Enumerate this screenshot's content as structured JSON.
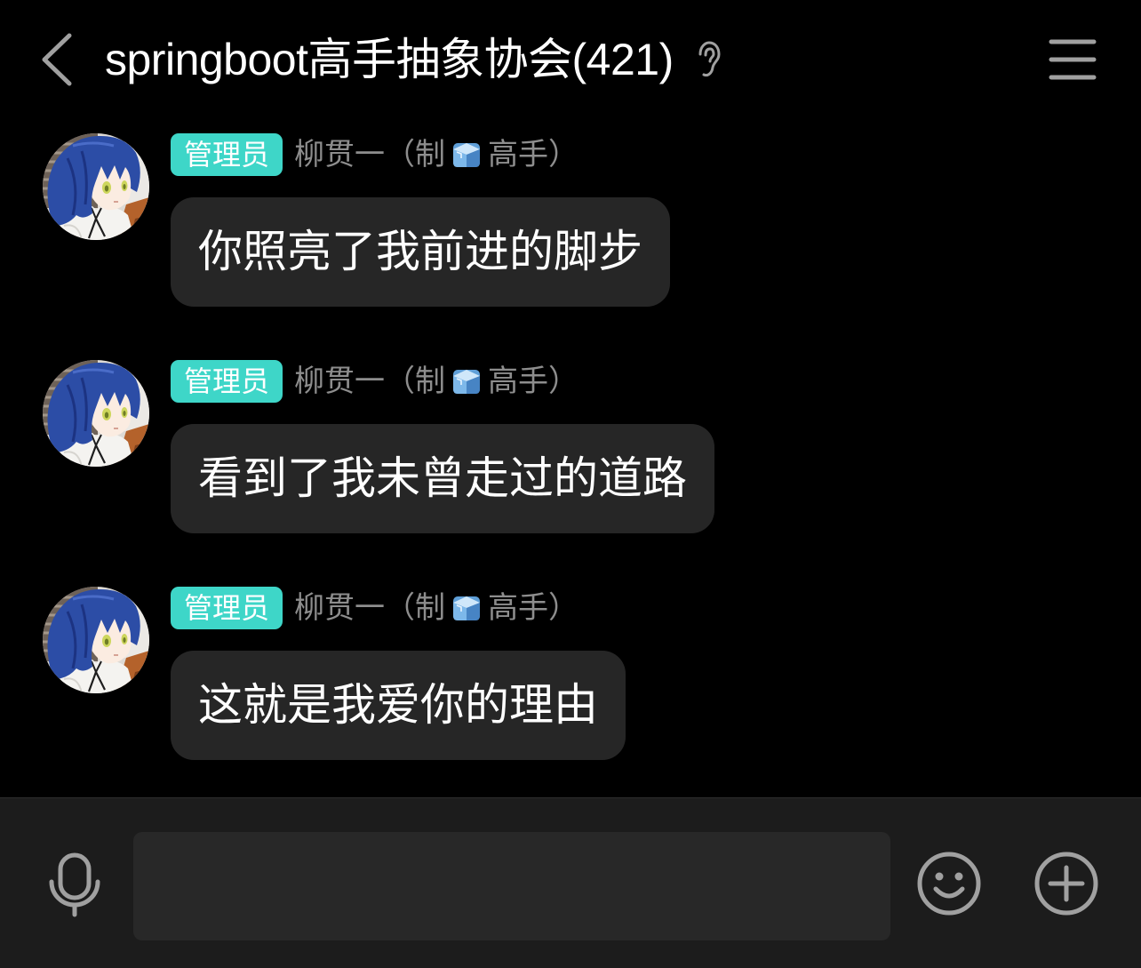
{
  "header": {
    "back_icon": "chevron-left-icon",
    "title": "springboot高手抽象协会(421)",
    "earpiece_icon": "ear-icon",
    "menu_icon": "hamburger-menu-icon"
  },
  "messages": [
    {
      "badge": "管理员",
      "sender_name_before_emoji": "柳贯一（制",
      "sender_name_emoji_icon": "ice-cube-icon",
      "sender_name_after_emoji": "高手）",
      "text": "你照亮了我前进的脚步"
    },
    {
      "badge": "管理员",
      "sender_name_before_emoji": "柳贯一（制",
      "sender_name_emoji_icon": "ice-cube-icon",
      "sender_name_after_emoji": "高手）",
      "text": "看到了我未曾走过的道路"
    },
    {
      "badge": "管理员",
      "sender_name_before_emoji": "柳贯一（制",
      "sender_name_emoji_icon": "ice-cube-icon",
      "sender_name_after_emoji": "高手）",
      "text": "这就是我爱你的理由"
    }
  ],
  "composer": {
    "voice_icon": "microphone-icon",
    "input_value": "",
    "emoji_icon": "smiley-face-icon",
    "more_icon": "plus-circle-icon"
  },
  "colors": {
    "background": "#000000",
    "title": "#ffffff",
    "bubble": "#262626",
    "badge": "#3ed6c8",
    "badge_text": "#ffffff",
    "sender_name": "#8d8d8d",
    "message_text": "#ffffff",
    "composer_bar": "#1c1c1c",
    "input_field": "#282828",
    "icon": "#a0a0a0"
  }
}
